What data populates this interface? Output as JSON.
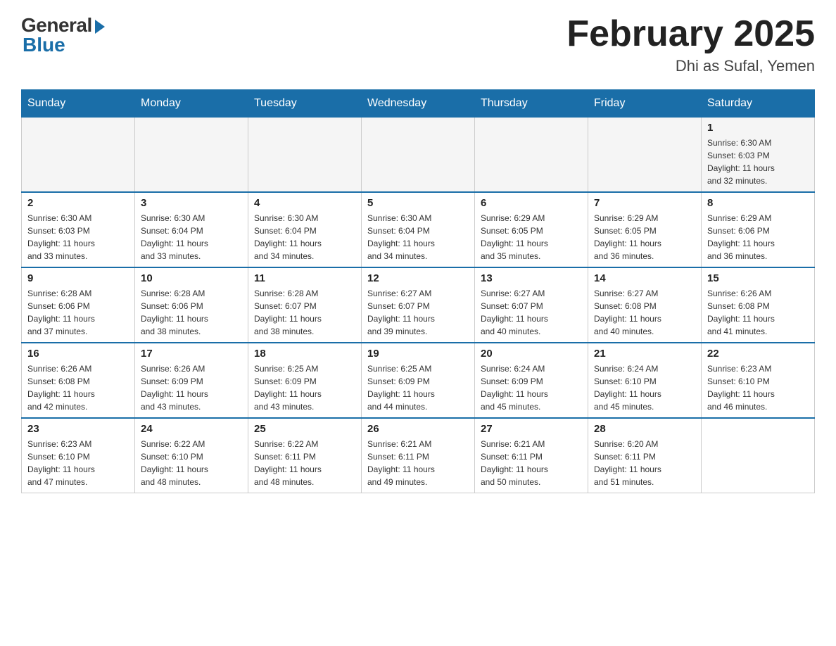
{
  "header": {
    "logo_general": "General",
    "logo_blue": "Blue",
    "title": "February 2025",
    "location": "Dhi as Sufal, Yemen"
  },
  "days_of_week": [
    "Sunday",
    "Monday",
    "Tuesday",
    "Wednesday",
    "Thursday",
    "Friday",
    "Saturday"
  ],
  "weeks": [
    {
      "days": [
        {
          "number": "",
          "info": ""
        },
        {
          "number": "",
          "info": ""
        },
        {
          "number": "",
          "info": ""
        },
        {
          "number": "",
          "info": ""
        },
        {
          "number": "",
          "info": ""
        },
        {
          "number": "",
          "info": ""
        },
        {
          "number": "1",
          "info": "Sunrise: 6:30 AM\nSunset: 6:03 PM\nDaylight: 11 hours\nand 32 minutes."
        }
      ]
    },
    {
      "days": [
        {
          "number": "2",
          "info": "Sunrise: 6:30 AM\nSunset: 6:03 PM\nDaylight: 11 hours\nand 33 minutes."
        },
        {
          "number": "3",
          "info": "Sunrise: 6:30 AM\nSunset: 6:04 PM\nDaylight: 11 hours\nand 33 minutes."
        },
        {
          "number": "4",
          "info": "Sunrise: 6:30 AM\nSunset: 6:04 PM\nDaylight: 11 hours\nand 34 minutes."
        },
        {
          "number": "5",
          "info": "Sunrise: 6:30 AM\nSunset: 6:04 PM\nDaylight: 11 hours\nand 34 minutes."
        },
        {
          "number": "6",
          "info": "Sunrise: 6:29 AM\nSunset: 6:05 PM\nDaylight: 11 hours\nand 35 minutes."
        },
        {
          "number": "7",
          "info": "Sunrise: 6:29 AM\nSunset: 6:05 PM\nDaylight: 11 hours\nand 36 minutes."
        },
        {
          "number": "8",
          "info": "Sunrise: 6:29 AM\nSunset: 6:06 PM\nDaylight: 11 hours\nand 36 minutes."
        }
      ]
    },
    {
      "days": [
        {
          "number": "9",
          "info": "Sunrise: 6:28 AM\nSunset: 6:06 PM\nDaylight: 11 hours\nand 37 minutes."
        },
        {
          "number": "10",
          "info": "Sunrise: 6:28 AM\nSunset: 6:06 PM\nDaylight: 11 hours\nand 38 minutes."
        },
        {
          "number": "11",
          "info": "Sunrise: 6:28 AM\nSunset: 6:07 PM\nDaylight: 11 hours\nand 38 minutes."
        },
        {
          "number": "12",
          "info": "Sunrise: 6:27 AM\nSunset: 6:07 PM\nDaylight: 11 hours\nand 39 minutes."
        },
        {
          "number": "13",
          "info": "Sunrise: 6:27 AM\nSunset: 6:07 PM\nDaylight: 11 hours\nand 40 minutes."
        },
        {
          "number": "14",
          "info": "Sunrise: 6:27 AM\nSunset: 6:08 PM\nDaylight: 11 hours\nand 40 minutes."
        },
        {
          "number": "15",
          "info": "Sunrise: 6:26 AM\nSunset: 6:08 PM\nDaylight: 11 hours\nand 41 minutes."
        }
      ]
    },
    {
      "days": [
        {
          "number": "16",
          "info": "Sunrise: 6:26 AM\nSunset: 6:08 PM\nDaylight: 11 hours\nand 42 minutes."
        },
        {
          "number": "17",
          "info": "Sunrise: 6:26 AM\nSunset: 6:09 PM\nDaylight: 11 hours\nand 43 minutes."
        },
        {
          "number": "18",
          "info": "Sunrise: 6:25 AM\nSunset: 6:09 PM\nDaylight: 11 hours\nand 43 minutes."
        },
        {
          "number": "19",
          "info": "Sunrise: 6:25 AM\nSunset: 6:09 PM\nDaylight: 11 hours\nand 44 minutes."
        },
        {
          "number": "20",
          "info": "Sunrise: 6:24 AM\nSunset: 6:09 PM\nDaylight: 11 hours\nand 45 minutes."
        },
        {
          "number": "21",
          "info": "Sunrise: 6:24 AM\nSunset: 6:10 PM\nDaylight: 11 hours\nand 45 minutes."
        },
        {
          "number": "22",
          "info": "Sunrise: 6:23 AM\nSunset: 6:10 PM\nDaylight: 11 hours\nand 46 minutes."
        }
      ]
    },
    {
      "days": [
        {
          "number": "23",
          "info": "Sunrise: 6:23 AM\nSunset: 6:10 PM\nDaylight: 11 hours\nand 47 minutes."
        },
        {
          "number": "24",
          "info": "Sunrise: 6:22 AM\nSunset: 6:10 PM\nDaylight: 11 hours\nand 48 minutes."
        },
        {
          "number": "25",
          "info": "Sunrise: 6:22 AM\nSunset: 6:11 PM\nDaylight: 11 hours\nand 48 minutes."
        },
        {
          "number": "26",
          "info": "Sunrise: 6:21 AM\nSunset: 6:11 PM\nDaylight: 11 hours\nand 49 minutes."
        },
        {
          "number": "27",
          "info": "Sunrise: 6:21 AM\nSunset: 6:11 PM\nDaylight: 11 hours\nand 50 minutes."
        },
        {
          "number": "28",
          "info": "Sunrise: 6:20 AM\nSunset: 6:11 PM\nDaylight: 11 hours\nand 51 minutes."
        },
        {
          "number": "",
          "info": ""
        }
      ]
    }
  ]
}
